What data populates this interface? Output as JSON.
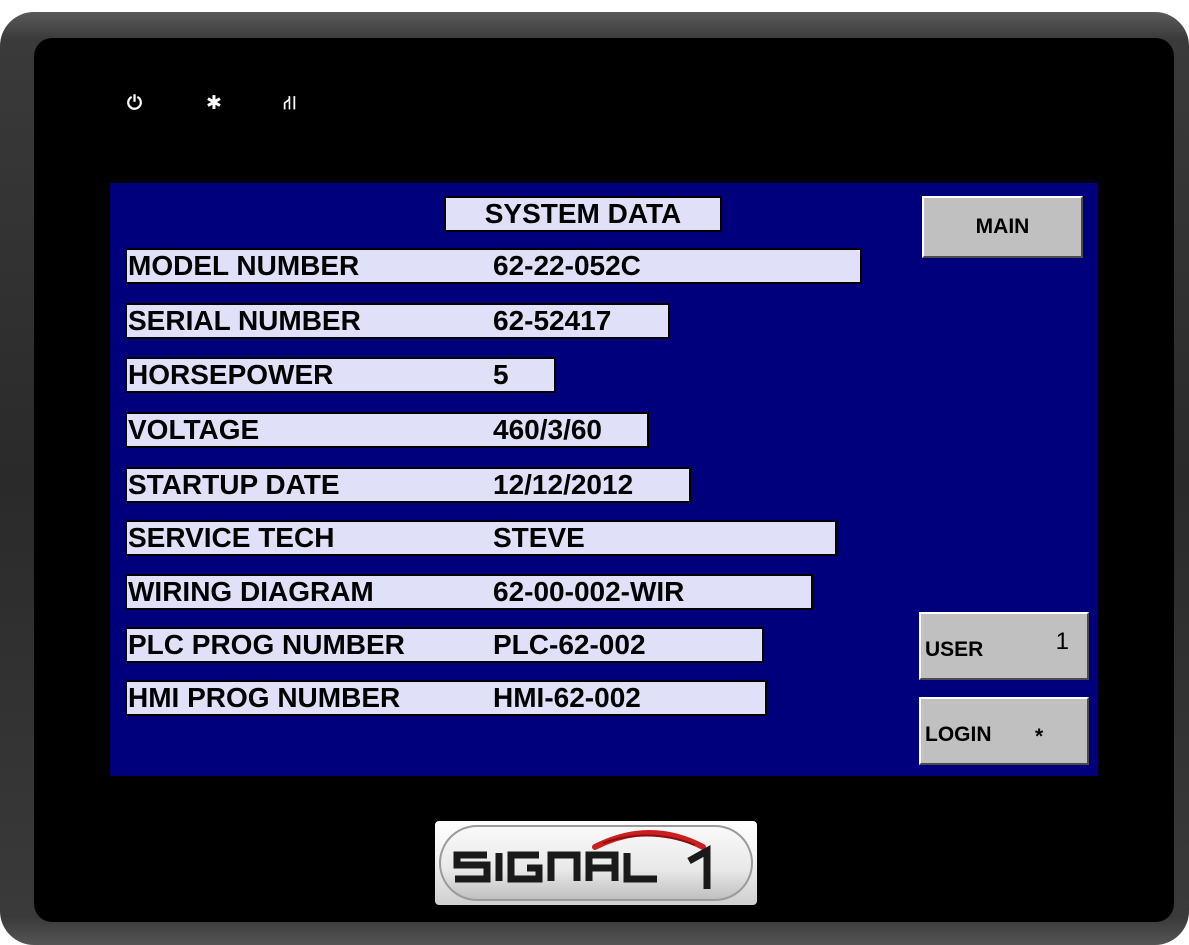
{
  "indicators": {
    "power": "⏻",
    "activity": "✱",
    "network": "⛙"
  },
  "screen": {
    "title": "SYSTEM DATA",
    "background_color": "#00007c",
    "field_color": "#e0e0f8",
    "rows": [
      {
        "label": "MODEL NUMBER",
        "value": "62-22-052C"
      },
      {
        "label": "SERIAL NUMBER",
        "value": "62-52417"
      },
      {
        "label": "HORSEPOWER",
        "value": "5"
      },
      {
        "label": "VOLTAGE",
        "value": "460/3/60"
      },
      {
        "label": "STARTUP DATE",
        "value": "12/12/2012"
      },
      {
        "label": "SERVICE TECH",
        "value": "STEVE"
      },
      {
        "label": "WIRING DIAGRAM",
        "value": "62-00-002-WIR"
      },
      {
        "label": "PLC PROG NUMBER",
        "value": "PLC-62-002"
      },
      {
        "label": "HMI PROG NUMBER",
        "value": "HMI-62-002"
      }
    ]
  },
  "buttons": {
    "main": "MAIN",
    "user_label": "USER",
    "user_value": "1",
    "login_label": "LOGIN",
    "login_value": "*"
  },
  "logo": {
    "text": "SIGNAL 1",
    "accent_color": "#cc1f1f"
  }
}
